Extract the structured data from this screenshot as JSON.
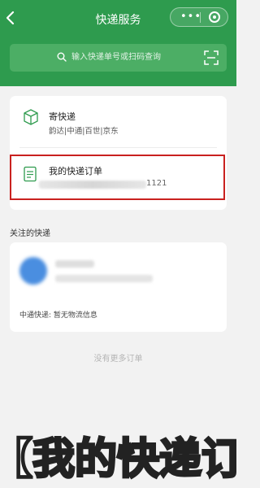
{
  "header": {
    "title": "快递服务",
    "dots_glyph": "•••"
  },
  "search": {
    "placeholder": "输入快递单号或扫码查询"
  },
  "send_row": {
    "title": "寄快递",
    "subtitle": "韵达|中通|百世|京东"
  },
  "orders_row": {
    "title": "我的快递订单",
    "number_visible_suffix": "1121"
  },
  "followed": {
    "section_label": "关注的快递",
    "status_text": "中通快递: 暂无物流信息"
  },
  "footer": {
    "no_more": "没有更多订单"
  },
  "overlay_caption": "【我的快递订"
}
